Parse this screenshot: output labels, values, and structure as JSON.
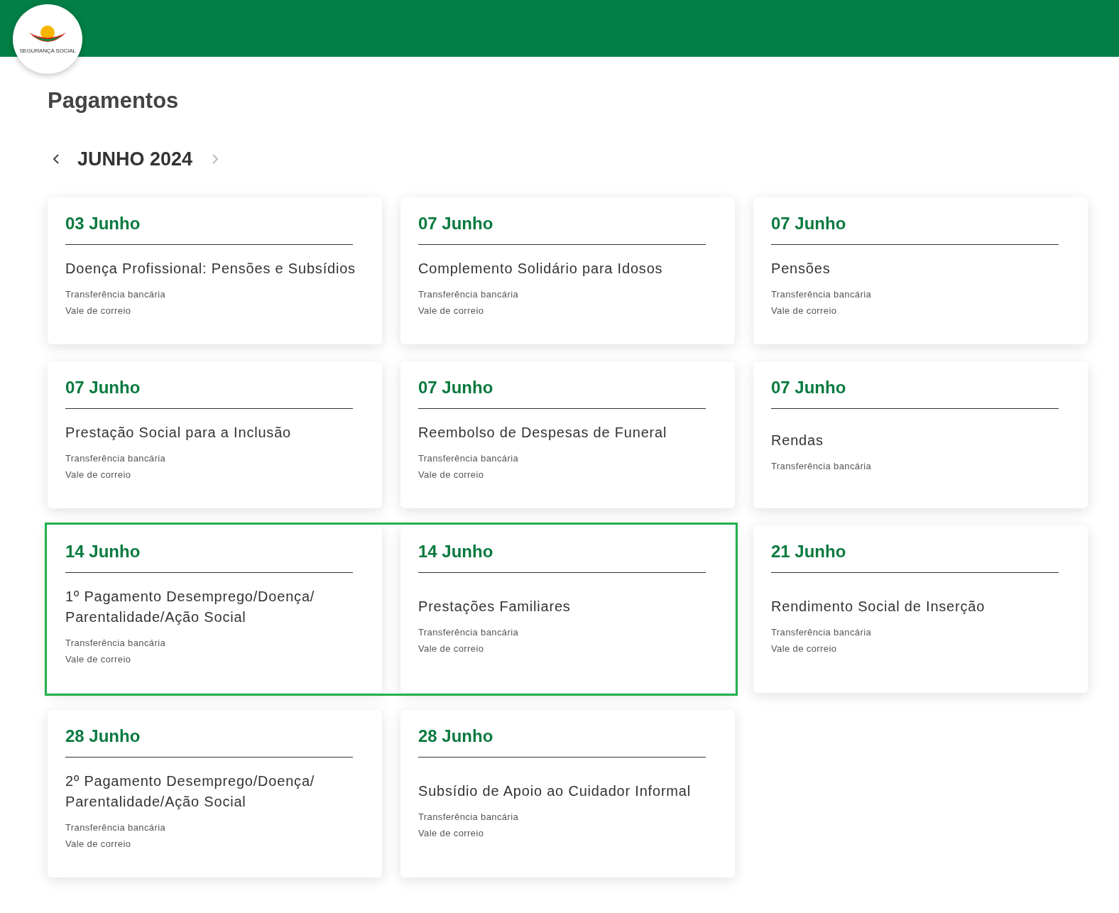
{
  "logo_text": "SEGURANÇA SOCIAL",
  "title": "Pagamentos",
  "month": "JUNHO 2024",
  "cards": [
    {
      "date": "03 Junho",
      "title": "Doença Profissional: Pensões e Subsídios",
      "methods": [
        "Transferência bancária",
        "Vale de correio"
      ],
      "highlighted": false
    },
    {
      "date": "07 Junho",
      "title": "Complemento Solidário para Idosos",
      "methods": [
        "Transferência bancária",
        "Vale de correio"
      ],
      "highlighted": false
    },
    {
      "date": "07 Junho",
      "title": "Pensões",
      "methods": [
        "Transferência bancária",
        "Vale de correio"
      ],
      "highlighted": false
    },
    {
      "date": "07 Junho",
      "title": "Prestação Social para a Inclusão",
      "methods": [
        "Transferência bancária",
        "Vale de correio"
      ],
      "highlighted": false
    },
    {
      "date": "07 Junho",
      "title": "Reembolso de Despesas de Funeral",
      "methods": [
        "Transferência bancária",
        "Vale de correio"
      ],
      "highlighted": false
    },
    {
      "date": "07 Junho",
      "title": "Rendas",
      "methods": [
        "Transferência bancária"
      ],
      "highlighted": false
    },
    {
      "date": "14 Junho",
      "title": "1º Pagamento Desemprego/Doença/ Parentalidade/Ação Social",
      "methods": [
        "Transferência bancária",
        "Vale de correio"
      ],
      "highlighted": true
    },
    {
      "date": "14 Junho",
      "title": "Prestações Familiares",
      "methods": [
        "Transferência bancária",
        "Vale de correio"
      ],
      "highlighted": true
    },
    {
      "date": "21 Junho",
      "title": "Rendimento Social de Inserção",
      "methods": [
        "Transferência bancária",
        "Vale de correio"
      ],
      "highlighted": false
    },
    {
      "date": "28 Junho",
      "title": "2º Pagamento Desemprego/Doença/ Parentalidade/Ação Social",
      "methods": [
        "Transferência bancária",
        "Vale de correio"
      ],
      "highlighted": false
    },
    {
      "date": "28 Junho",
      "title": "Subsídio de Apoio ao Cuidador Informal",
      "methods": [
        "Transferência bancária",
        "Vale de correio"
      ],
      "highlighted": false
    }
  ]
}
